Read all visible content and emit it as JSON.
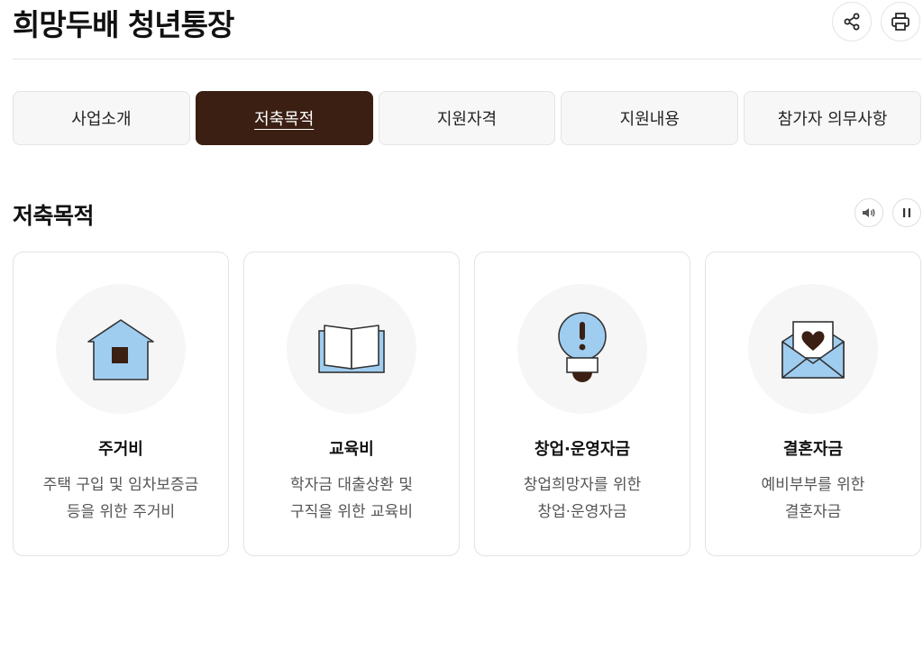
{
  "header": {
    "title": "희망두배 청년통장",
    "share_icon": "share-icon",
    "print_icon": "printer-icon"
  },
  "tabs": [
    {
      "label": "사업소개",
      "active": false
    },
    {
      "label": "저축목적",
      "active": true
    },
    {
      "label": "지원자격",
      "active": false
    },
    {
      "label": "지원내용",
      "active": false
    },
    {
      "label": "참가자 의무사항",
      "active": false
    }
  ],
  "section": {
    "title": "저축목적",
    "audio_icon": "speaker-icon",
    "pause_icon": "pause-icon"
  },
  "cards": [
    {
      "icon": "house-icon",
      "title": "주거비",
      "desc_line1": "주택 구입 및 임차보증금",
      "desc_line2": "등을 위한 주거비"
    },
    {
      "icon": "book-icon",
      "title": "교육비",
      "desc_line1": "학자금 대출상환 및",
      "desc_line2": "구직을 위한 교육비"
    },
    {
      "icon": "lightbulb-icon",
      "title": "창업·운영자금",
      "desc_line1": "창업희망자를 위한",
      "desc_line2": "창업·운영자금"
    },
    {
      "icon": "envelope-heart-icon",
      "title": "결혼자금",
      "desc_line1": "예비부부를 위한",
      "desc_line2": "결혼자금"
    }
  ],
  "colors": {
    "accent": "#3a1f12",
    "icon_fill": "#9fcdf0",
    "icon_stroke": "#333333"
  }
}
